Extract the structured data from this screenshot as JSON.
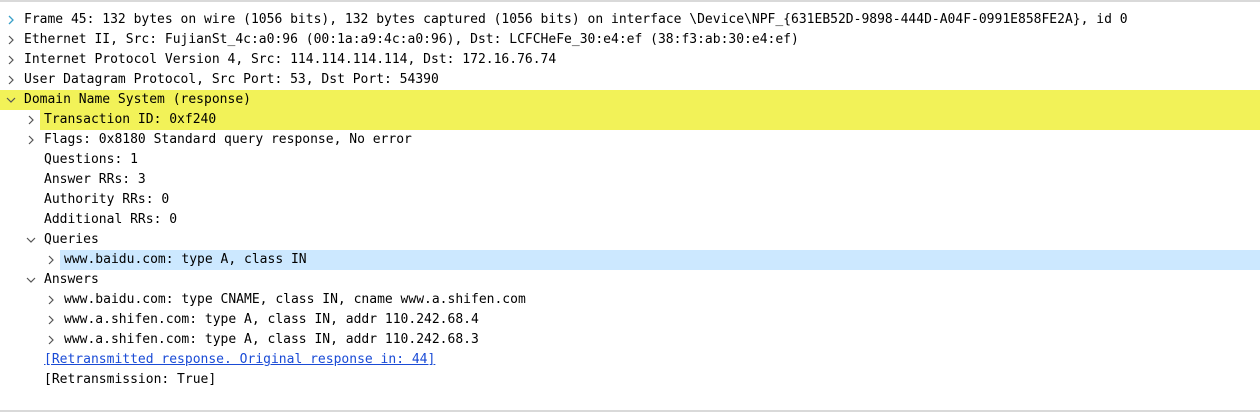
{
  "rows": [
    {
      "text": "Frame 45: 132 bytes on wire (1056 bits), 132 bytes captured (1056 bits) on interface \\Device\\NPF_{631EB52D-9898-444D-A04F-0991E858FE2A}, id 0",
      "expanded": false
    },
    {
      "text": "Ethernet II, Src: FujianSt_4c:a0:96 (00:1a:a9:4c:a0:96), Dst: LCFCHeFe_30:e4:ef (38:f3:ab:30:e4:ef)",
      "expanded": false
    },
    {
      "text": "Internet Protocol Version 4, Src: 114.114.114.114, Dst: 172.16.76.74",
      "expanded": false
    },
    {
      "text": "User Datagram Protocol, Src Port: 53, Dst Port: 54390",
      "expanded": false
    },
    {
      "text": "Domain Name System (response)",
      "expanded": true
    },
    {
      "text": "Transaction ID: 0xf240",
      "expanded": false
    },
    {
      "text": "Flags: 0x8180 Standard query response, No error",
      "expanded": false
    },
    {
      "text": "Questions: 1"
    },
    {
      "text": "Answer RRs: 3"
    },
    {
      "text": "Authority RRs: 0"
    },
    {
      "text": "Additional RRs: 0"
    },
    {
      "text": "Queries",
      "expanded": true
    },
    {
      "text": "www.baidu.com: type A, class IN",
      "expanded": false
    },
    {
      "text": "Answers",
      "expanded": true
    },
    {
      "text": "www.baidu.com: type CNAME, class IN, cname www.a.shifen.com",
      "expanded": false
    },
    {
      "text": "www.a.shifen.com: type A, class IN, addr 110.242.68.4",
      "expanded": false
    },
    {
      "text": "www.a.shifen.com: type A, class IN, addr 110.242.68.3",
      "expanded": false
    },
    {
      "text": "[Retransmitted response. Original response in: 44]"
    },
    {
      "text": "[Retransmission: True]"
    }
  ],
  "colors": {
    "highlight_yellow": "#f2f258",
    "highlight_blue": "#cce8ff",
    "link": "#1a4bd6",
    "arrow_frame": "#3aa0c8",
    "arrow": "#555555"
  },
  "icons": {
    "collapsed": "chevron-right-icon",
    "expanded": "chevron-down-icon"
  }
}
